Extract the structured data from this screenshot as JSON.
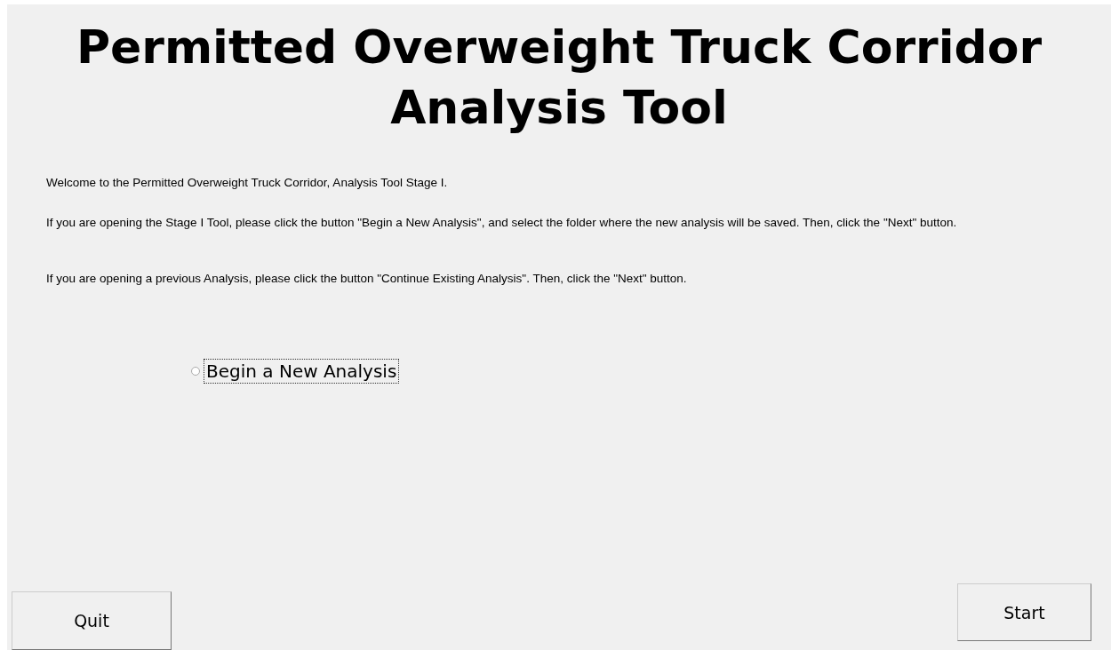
{
  "title": "Permitted Overweight Truck Corridor Analysis Tool",
  "paragraphs": [
    "Welcome to the Permitted Overweight Truck Corridor, Analysis Tool Stage I.",
    "If you are opening the Stage I Tool, please click the button \"Begin a New Analysis\", and select the folder where the new analysis will be saved. Then, click the \"Next\" button.",
    "If you are opening a previous Analysis, please click the button \"Continue Existing Analysis\". Then, click the \"Next\" button."
  ],
  "options": [
    {
      "label": "Begin a New Analysis",
      "selected": false,
      "focused": true
    }
  ],
  "buttons": [
    {
      "label": "Quit",
      "kind": "left"
    },
    {
      "label": "Start",
      "kind": "right"
    }
  ]
}
